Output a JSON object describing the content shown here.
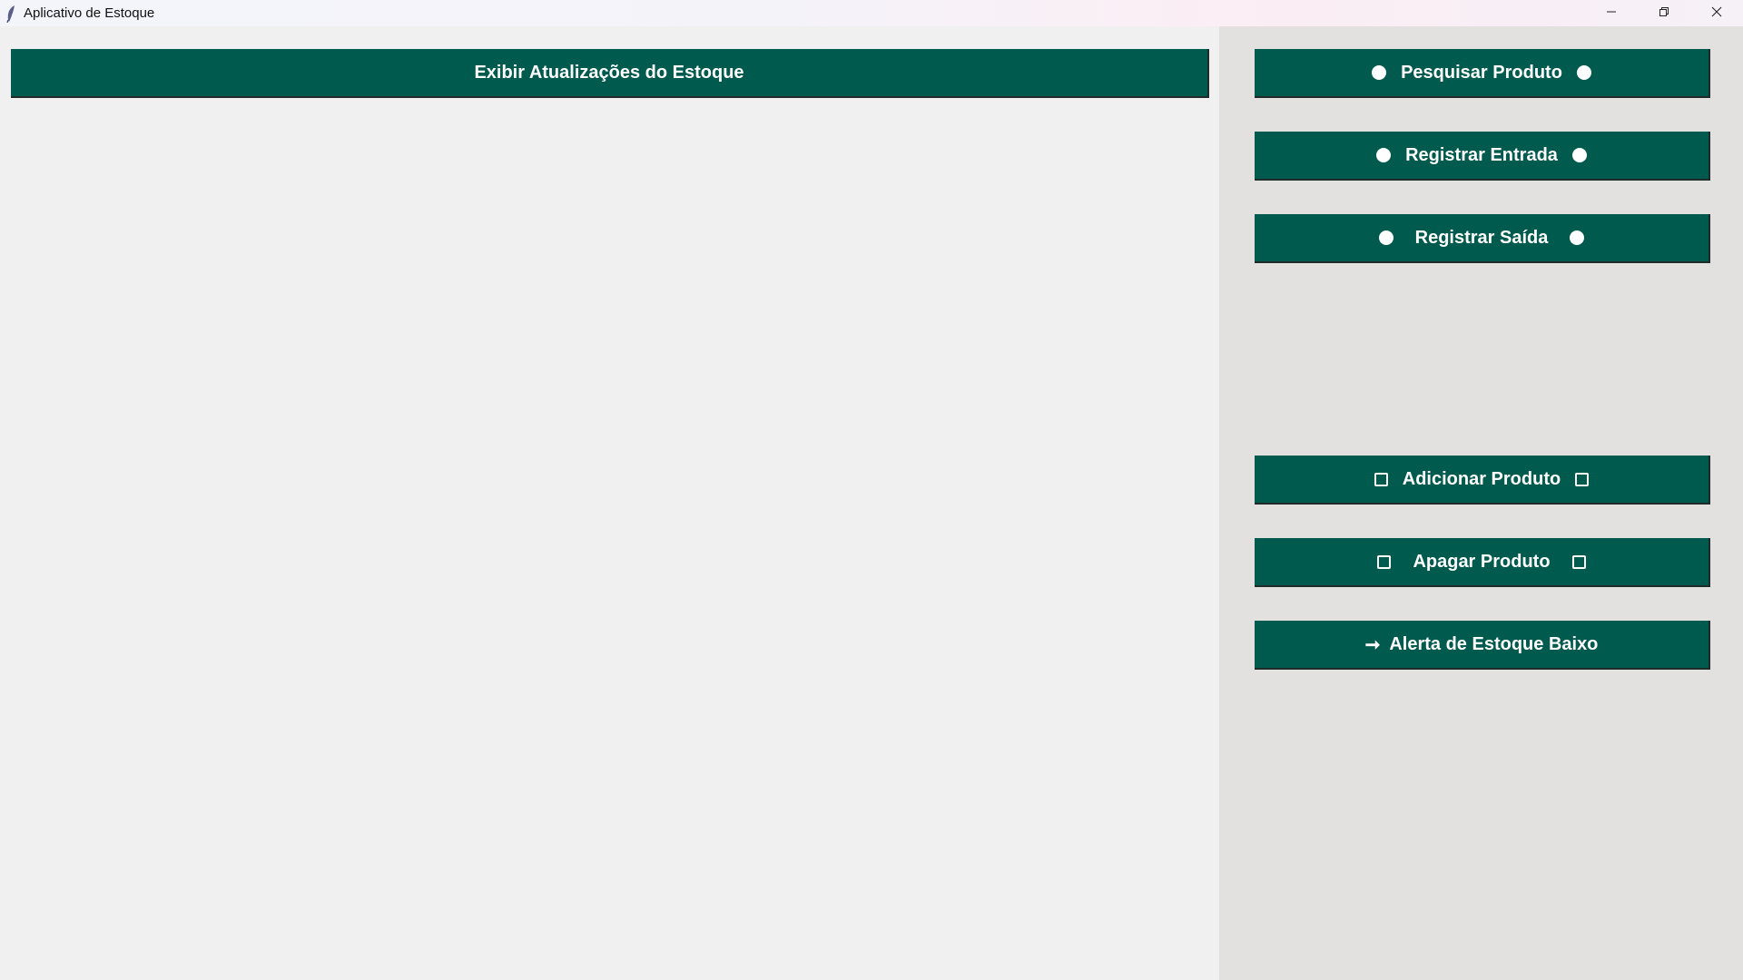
{
  "window": {
    "title": "Aplicativo de Estoque",
    "icon": "feather-icon",
    "controls": {
      "minimize": "minimize-icon",
      "restore": "restore-icon",
      "close": "close-icon"
    }
  },
  "main": {
    "show_updates_label": "Exibir Atualizações do Estoque"
  },
  "sidebar": {
    "search_label": "Pesquisar Produto",
    "entry_label": "Registrar Entrada",
    "exit_label": "Registrar Saída",
    "add_label": "Adicionar Produto",
    "delete_label": "Apagar Produto",
    "low_stock_label": "Alerta de Estoque Baixo",
    "low_stock_arrow": "➞"
  },
  "colors": {
    "button_bg": "#005a4e",
    "button_text": "#ffffff",
    "left_panel_bg": "#f0f0f0",
    "right_panel_bg": "#e2e1df"
  }
}
